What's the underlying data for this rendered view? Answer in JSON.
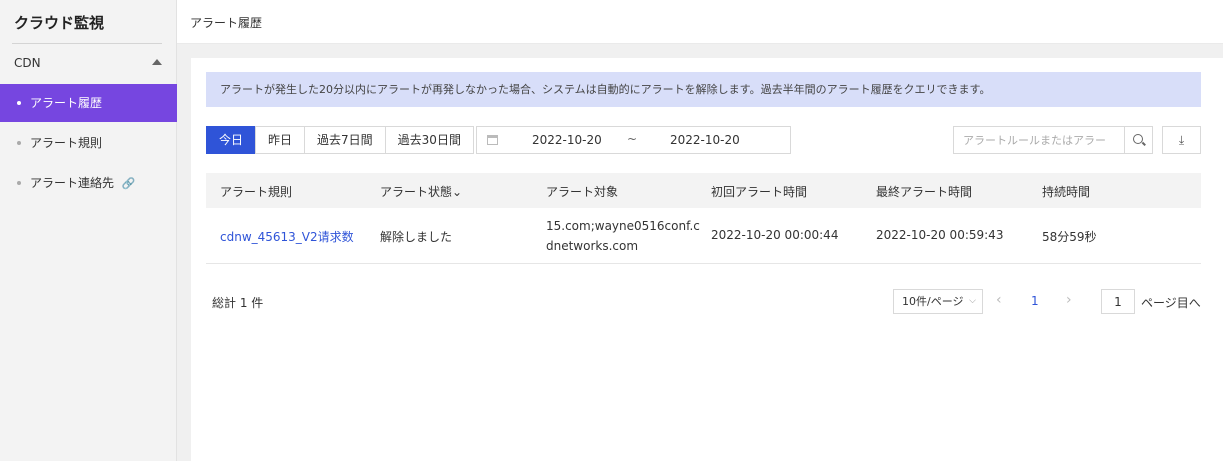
{
  "sidebar": {
    "title": "クラウド監視",
    "section": "CDN",
    "items": [
      {
        "label": "アラート履歴",
        "active": true
      },
      {
        "label": "アラート規則",
        "active": false
      },
      {
        "label": "アラート連絡先",
        "active": false
      }
    ]
  },
  "header": {
    "title": "アラート履歴"
  },
  "notice": "アラートが発生した20分以内にアラートが再発しなかった場合、システムは自動的にアラートを解除します。過去半年間のアラート履歴をクエリできます。",
  "filters": {
    "ranges": [
      "今日",
      "昨日",
      "過去7日間",
      "過去30日間"
    ],
    "active_range": "今日",
    "date_start": "2022-10-20",
    "date_sep": "~",
    "date_end": "2022-10-20",
    "search_placeholder": "アラートルールまたはアラー"
  },
  "table": {
    "columns": [
      "アラート規則",
      "アラート状態",
      "アラート対象",
      "初回アラート時間",
      "最終アラート時間",
      "持続時間"
    ],
    "rows": [
      {
        "rule": "cdnw_45613_V2请求数",
        "status": "解除しました",
        "target": "15.com;wayne0516conf.cdnetworks.com",
        "first_time": "2022-10-20 00:00:44",
        "last_time": "2022-10-20 00:59:43",
        "duration": "58分59秒"
      }
    ]
  },
  "pagination": {
    "total": "総計 1 件",
    "page_size": "10件/ページ",
    "current_page": "1",
    "goto_value": "1",
    "goto_suffix": "ページ目へ"
  },
  "colors": {
    "accent": "#2f54d8",
    "sidebar_active": "#7646e0",
    "notice_bg": "#d8def9"
  }
}
